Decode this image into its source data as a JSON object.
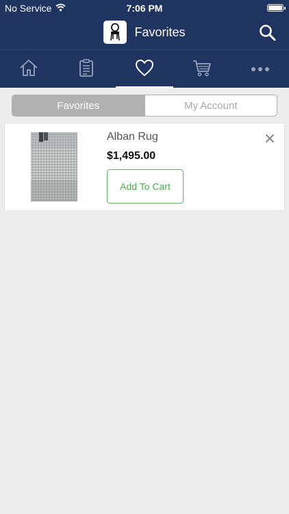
{
  "status_bar": {
    "carrier": "No Service",
    "time": "7:06 PM",
    "battery_level": 1.0
  },
  "nav": {
    "title": "Favorites",
    "logo_icon": "chair-icon",
    "search_icon": "search-icon"
  },
  "tabs": [
    {
      "icon": "home-icon",
      "active": false
    },
    {
      "icon": "clipboard-icon",
      "active": false
    },
    {
      "icon": "heart-icon",
      "active": true
    },
    {
      "icon": "cart-icon",
      "active": false
    },
    {
      "icon": "more-icon",
      "active": false
    }
  ],
  "segments": {
    "favorites": "Favorites",
    "my_account": "My Account",
    "selected": "Favorites"
  },
  "favorites": [
    {
      "name": "Alban Rug",
      "price": "$1,495.00",
      "button_label": "Add To Cart",
      "remove_icon": "close-icon"
    }
  ],
  "colors": {
    "nav_bg": "#1f3461",
    "page_bg": "#ececec",
    "accent_green": "#5cb85c",
    "segment_active": "#b1b1b1"
  }
}
